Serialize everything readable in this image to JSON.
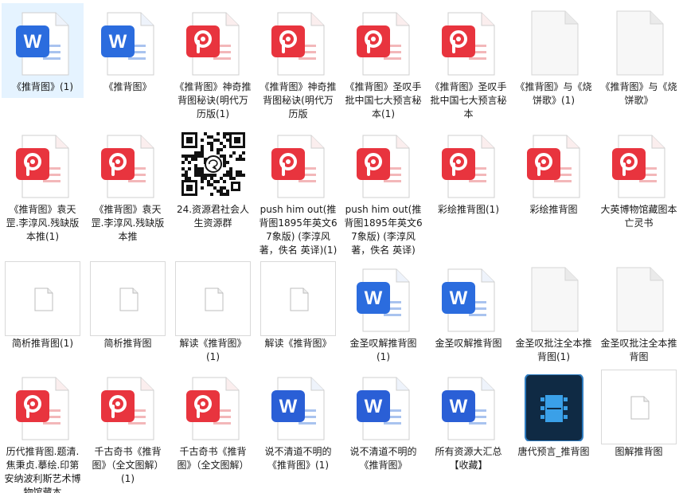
{
  "files": [
    {
      "name": "《推背图》(1)",
      "type": "word",
      "selected": true
    },
    {
      "name": "《推背图》",
      "type": "word"
    },
    {
      "name": "《推背图》神奇推背图秘诀(明代万历版(1)",
      "type": "pdf"
    },
    {
      "name": "《推背图》神奇推背图秘诀(明代万历版",
      "type": "pdf"
    },
    {
      "name": "《推背图》圣叹手批中国七大预言秘本(1)",
      "type": "pdf"
    },
    {
      "name": "《推背图》圣叹手批中国七大预言秘本",
      "type": "pdf"
    },
    {
      "name": "《推背图》与《烧饼歌》(1)",
      "type": "blank"
    },
    {
      "name": "《推背图》与《烧饼歌》",
      "type": "blank"
    },
    {
      "name": "《推背图》袁天罡.李淳风.残缺版本推(1)",
      "type": "pdf"
    },
    {
      "name": "《推背图》袁天罡.李淳风.残缺版本推",
      "type": "pdf"
    },
    {
      "name": "24.资源君社会人生资源群",
      "type": "qr"
    },
    {
      "name": "push him out(推背图1895年英文67象版) (李淳风著，佚名 英译)(1)",
      "type": "pdf"
    },
    {
      "name": "push him out(推背图1895年英文67象版) (李淳风著，佚名 英译)",
      "type": "pdf"
    },
    {
      "name": "彩绘推背图(1)",
      "type": "pdf"
    },
    {
      "name": "彩绘推背图",
      "type": "pdf"
    },
    {
      "name": "大英博物馆藏图本 亡灵书",
      "type": "pdf"
    },
    {
      "name": "简析推背图(1)",
      "type": "box"
    },
    {
      "name": "简析推背图",
      "type": "box"
    },
    {
      "name": "解读《推背图》(1)",
      "type": "box"
    },
    {
      "name": "解读《推背图》",
      "type": "box"
    },
    {
      "name": "金圣叹解推背图(1)",
      "type": "word"
    },
    {
      "name": "金圣叹解推背图",
      "type": "word"
    },
    {
      "name": "金圣叹批注全本推背图(1)",
      "type": "blank"
    },
    {
      "name": "金圣叹批注全本推背图",
      "type": "blank"
    },
    {
      "name": "历代推背图.题清.焦秉贞.摹绘.印第安纳波利斯艺术博物馆藏本",
      "type": "pdf"
    },
    {
      "name": "千古奇书《推背图》（全文图解）(1)",
      "type": "pdf"
    },
    {
      "name": "千古奇书《推背图》（全文图解）",
      "type": "pdf"
    },
    {
      "name": "说不清道不明的《推背图》(1)",
      "type": "word-blue"
    },
    {
      "name": "说不清道不明的《推背图》",
      "type": "word-blue"
    },
    {
      "name": "所有资源大汇总【收藏】",
      "type": "word-blue"
    },
    {
      "name": "唐代预言_推背图",
      "type": "video"
    },
    {
      "name": "图解推背图",
      "type": "box"
    }
  ],
  "colors": {
    "pdf_red": "#e8343e",
    "word_blue": "#2b6cde",
    "selected_bg": "#e5f3ff",
    "video_bg": "#0f2a44",
    "video_accent": "#3aa0e8"
  }
}
